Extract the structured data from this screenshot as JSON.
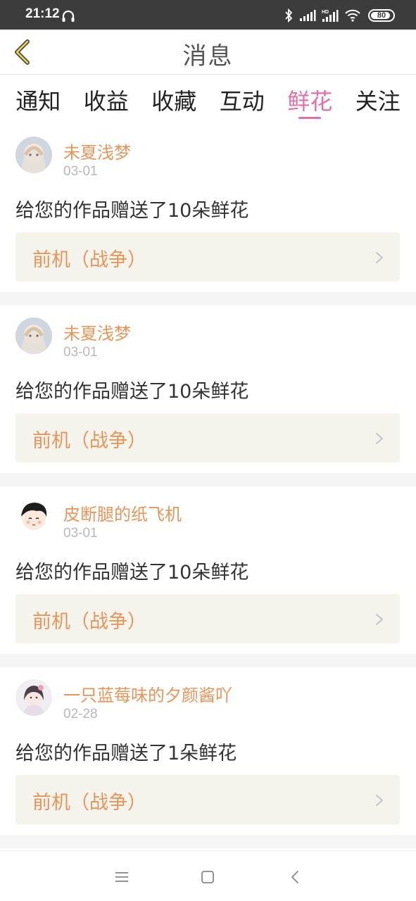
{
  "status_bar": {
    "time": "21:12",
    "battery": "80",
    "icons": [
      "headset-icon",
      "bluetooth-icon",
      "signal-icon",
      "signal-hd-icon",
      "wifi-icon",
      "battery-icon"
    ]
  },
  "header": {
    "title": "消息",
    "back_icon": "chevron-left-icon"
  },
  "tabs": [
    {
      "label": "通知",
      "active": false
    },
    {
      "label": "收益",
      "active": false
    },
    {
      "label": "收藏",
      "active": false
    },
    {
      "label": "互动",
      "active": false
    },
    {
      "label": "鲜花",
      "active": true
    },
    {
      "label": "关注",
      "active": false
    }
  ],
  "colors": {
    "accent_pink": "#e46fa8",
    "username_orange": "#e8955a",
    "work_box_bg": "#f4f3ec",
    "status_bar_bg": "#3c3c3c"
  },
  "messages": [
    {
      "user": "未夏浅梦",
      "date": "03-01",
      "text": "给您的作品赠送了10朵鲜花",
      "work": "前机（战争）"
    },
    {
      "user": "未夏浅梦",
      "date": "03-01",
      "text": "给您的作品赠送了10朵鲜花",
      "work": "前机（战争）"
    },
    {
      "user": "皮断腿的纸飞机",
      "date": "03-01",
      "text": "给您的作品赠送了10朵鲜花",
      "work": "前机（战争）"
    },
    {
      "user": "一只蓝莓味的夕颜酱吖",
      "date": "02-28",
      "text": "给您的作品赠送了1朵鲜花",
      "work": "前机（战争）"
    }
  ],
  "navbar": {
    "icons": [
      "menu-icon",
      "home-square-icon",
      "back-triangle-icon"
    ]
  }
}
